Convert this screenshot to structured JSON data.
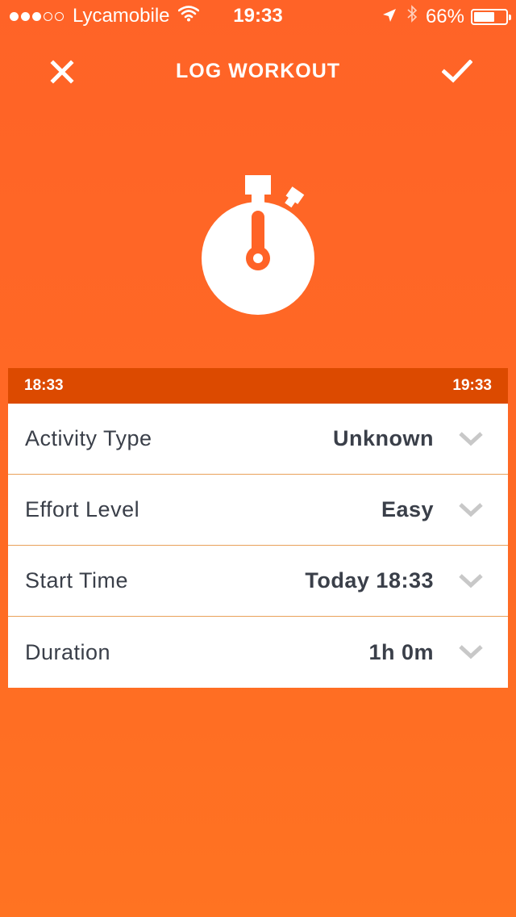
{
  "status_bar": {
    "carrier": "Lycamobile",
    "time": "19:33",
    "battery_percent": "66%",
    "battery_level": 0.66,
    "signal_bars_filled": 3,
    "signal_bars_total": 5
  },
  "nav": {
    "title": "LOG WORKOUT",
    "close_icon": "close-icon",
    "confirm_icon": "checkmark-icon"
  },
  "hero_icon": "stopwatch-icon",
  "timeline": {
    "start": "18:33",
    "end": "19:33"
  },
  "form": {
    "rows": [
      {
        "label": "Activity Type",
        "value": "Unknown"
      },
      {
        "label": "Effort Level",
        "value": "Easy"
      },
      {
        "label": "Start Time",
        "value": "Today 18:33"
      },
      {
        "label": "Duration",
        "value": "1h 0m"
      }
    ]
  },
  "colors": {
    "background": "#ff6327",
    "timeline_bar": "#dc4a00",
    "text_dark": "#3a3f49",
    "chevron": "#c8c8c8",
    "divider": "#e9a15a"
  }
}
